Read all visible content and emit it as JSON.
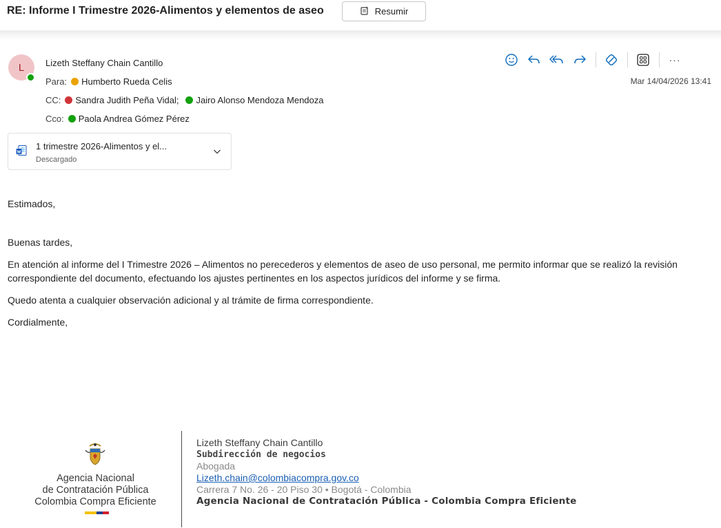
{
  "message": {
    "subject": "RE: Informe I Trimestre 2026-Alimentos y elementos de aseo",
    "summarize_label": "Resumir",
    "sender": {
      "initial": "L",
      "name": "Lizeth Steffany Chain Cantillo"
    },
    "to": {
      "label": "Para:",
      "recipients": [
        "Humberto Rueda Celis"
      ]
    },
    "cc": {
      "label": "CC:",
      "recipients": [
        "Sandra Judith Peña Vidal;",
        "Jairo Alonso Mendoza Mendoza"
      ]
    },
    "bcc": {
      "label": "Cco:",
      "recipients": [
        "Paola Andrea Gómez Pérez"
      ]
    },
    "date": "Mar 14/04/2026 13:41"
  },
  "toolbar": {
    "icons": [
      "emoji-icon",
      "reply-icon",
      "reply-all-icon",
      "forward-icon",
      "loop-icon",
      "apps-icon",
      "more-icon"
    ],
    "more_label": "···"
  },
  "attachment": {
    "name": "1 trimestre 2026-Alimentos y el...",
    "status": "Descargado"
  },
  "body": {
    "greeting": "Estimados,",
    "salutation": "Buenas tardes,",
    "paragraph1": "En atención al informe del I Trimestre 2026 – Alimentos no perecederos y elementos de aseo de uso personal, me permito informar que se realizó la revisión correspondiente del documento, efectuando los ajustes pertinentes en los aspectos jurídicos del informe y se firma.",
    "paragraph2": "Quedo atenta a cualquier observación adicional y al trámite de firma correspondiente.",
    "closing": "Cordialmente,"
  },
  "signature": {
    "logo_lines": [
      "Agencia Nacional",
      "de Contratación Pública",
      "Colombia Compra Eficiente"
    ],
    "name": "Lizeth Steffany Chain Cantillo",
    "department": "Subdirección de negocios",
    "role": "Abogada",
    "email": "Lizeth.chain@colombiacompra.gov.co",
    "address": "Carrera 7 No. 26 - 20 Piso 30 • Bogotá - Colombia",
    "organization": "Agencia Nacional de Contratación Pública - Colombia Compra Eficiente"
  },
  "colors": {
    "presence_available": "#13a10e",
    "presence_away": "#eaa300",
    "presence_busy": "#d13438",
    "toolbar_accent": "#0f6cbd"
  }
}
